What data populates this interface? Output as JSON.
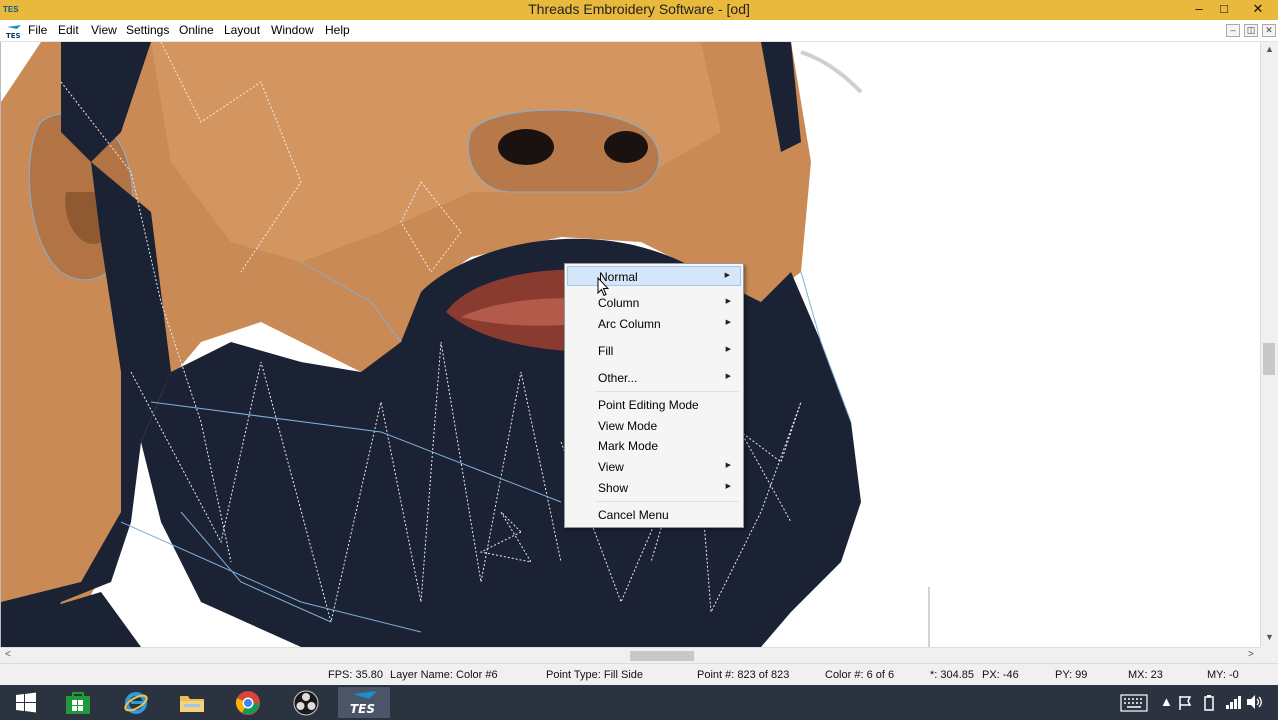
{
  "window": {
    "title": "Threads Embroidery Software - [od]",
    "app_icon_text": "TES",
    "minimize_glyph": "–",
    "maximize_glyph": "□",
    "close_glyph": "✕"
  },
  "menubar": {
    "items": [
      "File",
      "Edit",
      "View",
      "Settings",
      "Online",
      "Layout",
      "Window",
      "Help"
    ],
    "mdi_minimize": "–",
    "mdi_restore": "◫",
    "mdi_close": "✕"
  },
  "context_menu": {
    "items": [
      {
        "label": "Normal",
        "submenu": true,
        "highlighted": true
      },
      {
        "label": "Column",
        "submenu": true
      },
      {
        "label": "Arc Column",
        "submenu": true
      },
      {
        "label": "Fill",
        "submenu": true
      },
      {
        "label": "Other...",
        "submenu": true
      },
      {
        "label": "Point Editing Mode",
        "submenu": false
      },
      {
        "label": "View Mode",
        "submenu": false
      },
      {
        "label": "Mark Mode",
        "submenu": false
      },
      {
        "label": "View",
        "submenu": true
      },
      {
        "label": "Show",
        "submenu": true
      },
      {
        "label": "Cancel Menu",
        "submenu": false
      }
    ],
    "arrow_glyph": "▶"
  },
  "statusbar": {
    "fps": "FPS: 35.80",
    "layer_name": "Layer Name: Color #6",
    "point_type": "Point Type: Fill Side",
    "point_num": "Point #: 823 of 823",
    "color_num": "Color #: 6 of 6",
    "angle": "*: 304.85",
    "px": "PX: -46",
    "py": "PY: 99",
    "mx": "MX:  23",
    "my": "MY:  -0"
  },
  "scroll": {
    "up": "▲",
    "down": "▼",
    "left": "<",
    "right": ">"
  },
  "taskbar": {
    "tes_label": "TES"
  },
  "colors": {
    "titlebar": "#e8b93d",
    "skin": "#c98a55",
    "beard": "#1b2233",
    "lips": "#8a3b30",
    "outline": "#7fb0d8",
    "menu_highlight": "#d5e6f8",
    "taskbar": "#2b3340"
  }
}
